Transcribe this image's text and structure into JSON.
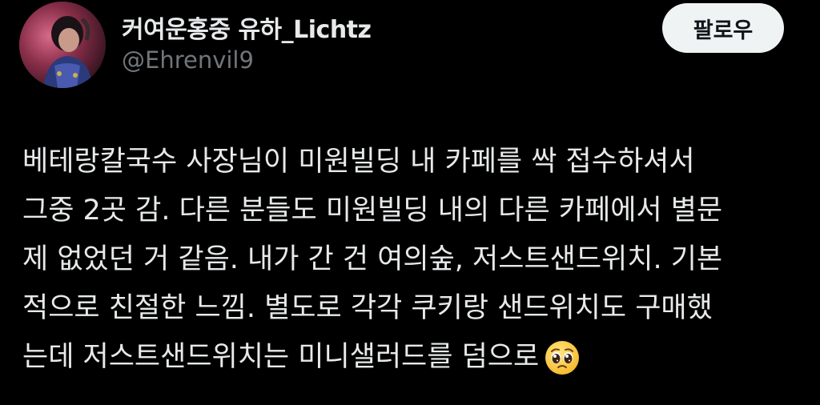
{
  "author": {
    "display_name": "커여운홍중 유하_Lichtz",
    "handle": "@Ehrenvil9",
    "avatar_icon": "profile-photo"
  },
  "follow_button": {
    "label": "팔로우"
  },
  "tweet": {
    "lines": [
      "베테랑칼국수 사장님이 미원빌딩 내 카페를 싹 접수하셔서",
      "그중 2곳 감. 다른 분들도 미원빌딩 내의 다른 카페에서 별문",
      "제 없었던 거 같음. 내가 간 건 여의숲, 저스트샌드위치. 기본",
      "적으로 친절한 느낌. 별도로 각각 쿠키랑 샌드위치도 구매했",
      "는데 저스트샌드위치는 미니샐러드를 덤으로"
    ],
    "trailing_emoji": "pleading-face-emoji"
  },
  "colors": {
    "background": "#000000",
    "text_primary": "#e7e9ea",
    "text_secondary": "#71767b",
    "button_bg": "#eff3f4",
    "button_text": "#0f1419"
  }
}
